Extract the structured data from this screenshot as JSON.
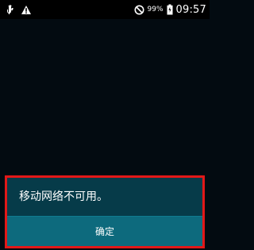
{
  "status_bar": {
    "battery_percent": "99%",
    "time": "09:57",
    "icons": [
      "usb-icon",
      "warning-icon",
      "do-not-disturb-icon",
      "battery-charging-icon"
    ]
  },
  "dialog": {
    "message": "移动网络不可用。",
    "confirm_label": "确定"
  },
  "colors": {
    "background": "#030b11",
    "dialog_body": "#063b49",
    "dialog_button": "#0d6a7d",
    "highlight_border": "#e31818",
    "text": "#ffffff"
  }
}
